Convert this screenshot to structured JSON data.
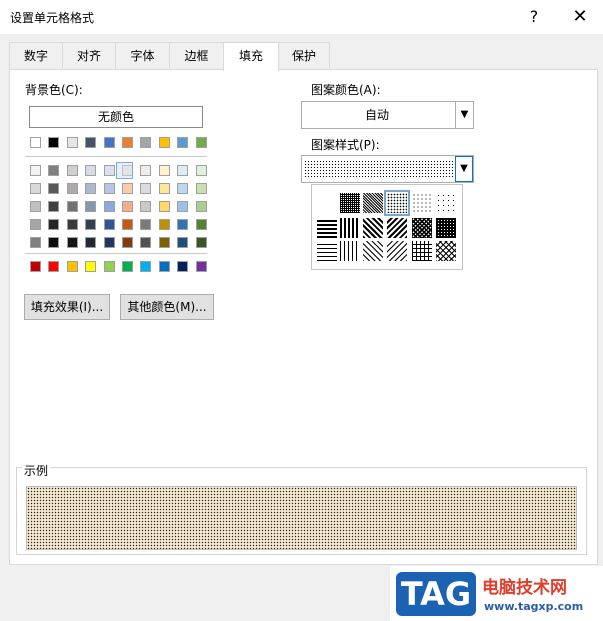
{
  "title": "设置单元格格式",
  "help": "?",
  "close": "✕",
  "tabs": [
    "数字",
    "对齐",
    "字体",
    "边框",
    "填充",
    "保护"
  ],
  "active_tab": "填充",
  "background_label": "背景色(C):",
  "no_color": "无颜色",
  "theme_colors": [
    "#ffffff",
    "#000000",
    "#e7e6e6",
    "#44546a",
    "#4472c4",
    "#ed7d31",
    "#a5a5a5",
    "#ffc000",
    "#5b9bd5",
    "#70ad47"
  ],
  "tint_rows": [
    [
      "#f2f2f2",
      "#7f7f7f",
      "#d0cece",
      "#d6dce4",
      "#d9e1f2",
      "#fce4d6",
      "#ededed",
      "#fff2cc",
      "#ddebf7",
      "#e2efda"
    ],
    [
      "#d9d9d9",
      "#595959",
      "#aeaaaa",
      "#acb9ca",
      "#b4c6e7",
      "#f8cbad",
      "#dbdbdb",
      "#ffe699",
      "#bdd7ee",
      "#c6e0b4"
    ],
    [
      "#bfbfbf",
      "#404040",
      "#757171",
      "#8497b0",
      "#8ea9db",
      "#f4b084",
      "#c9c9c9",
      "#ffd966",
      "#9bc2e6",
      "#a9d08e"
    ],
    [
      "#a6a6a6",
      "#262626",
      "#3a3838",
      "#333f4f",
      "#2f5597",
      "#c65911",
      "#7b7b7b",
      "#bf8f00",
      "#2f75b5",
      "#548235"
    ],
    [
      "#808080",
      "#0d0d0d",
      "#161616",
      "#222b35",
      "#203764",
      "#833c0c",
      "#525252",
      "#806000",
      "#1f4e78",
      "#375623"
    ]
  ],
  "standard_colors": [
    "#c00000",
    "#ff0000",
    "#ffc000",
    "#ffff00",
    "#92d050",
    "#00b050",
    "#00b0f0",
    "#0070c0",
    "#002060",
    "#7030a0"
  ],
  "fill_effects_button": "填充效果(I)...",
  "more_colors_button": "其他颜色(M)...",
  "pattern_color_label": "图案颜色(A):",
  "pattern_color_value": "自动",
  "pattern_style_label": "图案样式(P):",
  "sample_label": "示例",
  "watermark_logo": "TAG",
  "watermark_cn": "电脑技术网",
  "watermark_url": "www.tagxp.com"
}
